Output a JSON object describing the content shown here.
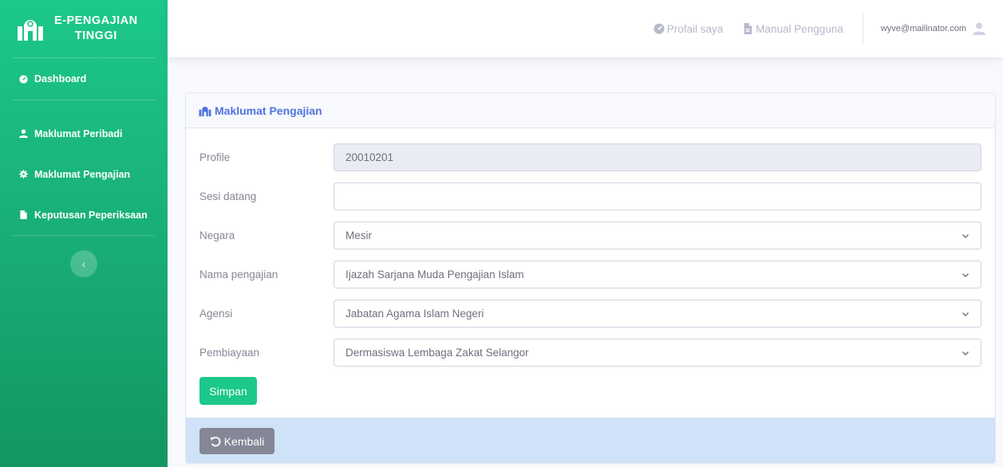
{
  "sidebar": {
    "brand_line1": "E-PENGAJIAN",
    "brand_line2": "TINGGI",
    "items": [
      {
        "label": "Dashboard",
        "icon": "dashboard-icon"
      },
      {
        "label": "Maklumat Peribadi",
        "icon": "user-icon"
      },
      {
        "label": "Maklumat Pengajian",
        "icon": "cog-icon"
      },
      {
        "label": "Keputusan Peperiksaan",
        "icon": "file-icon"
      }
    ],
    "toggle_icon": "chevron-left-icon"
  },
  "topbar": {
    "profile_link": "Profail saya",
    "manual_link": "Manual Pengguna",
    "user_email": "wyve@mailinator.com"
  },
  "card": {
    "title": "Maklumat Pengajian",
    "fields": [
      {
        "label": "Profile",
        "value": "20010201",
        "type": "readonly"
      },
      {
        "label": "Sesi datang",
        "value": "",
        "type": "text"
      },
      {
        "label": "Negara",
        "value": "Mesir",
        "type": "select"
      },
      {
        "label": "Nama pengajian",
        "value": "Ijazah Sarjana Muda Pengajian Islam",
        "type": "select"
      },
      {
        "label": "Agensi",
        "value": "Jabatan Agama Islam Negeri",
        "type": "select"
      },
      {
        "label": "Pembiayaan",
        "value": "Dermasiswa Lembaga Zakat Selangor",
        "type": "select"
      }
    ],
    "save_label": "Simpan",
    "back_label": "Kembali"
  },
  "colors": {
    "sidebar": "#1cc88a",
    "primary": "#4e73df",
    "success": "#1cc88a",
    "secondary": "#858796",
    "footer": "#cfe2f7"
  }
}
